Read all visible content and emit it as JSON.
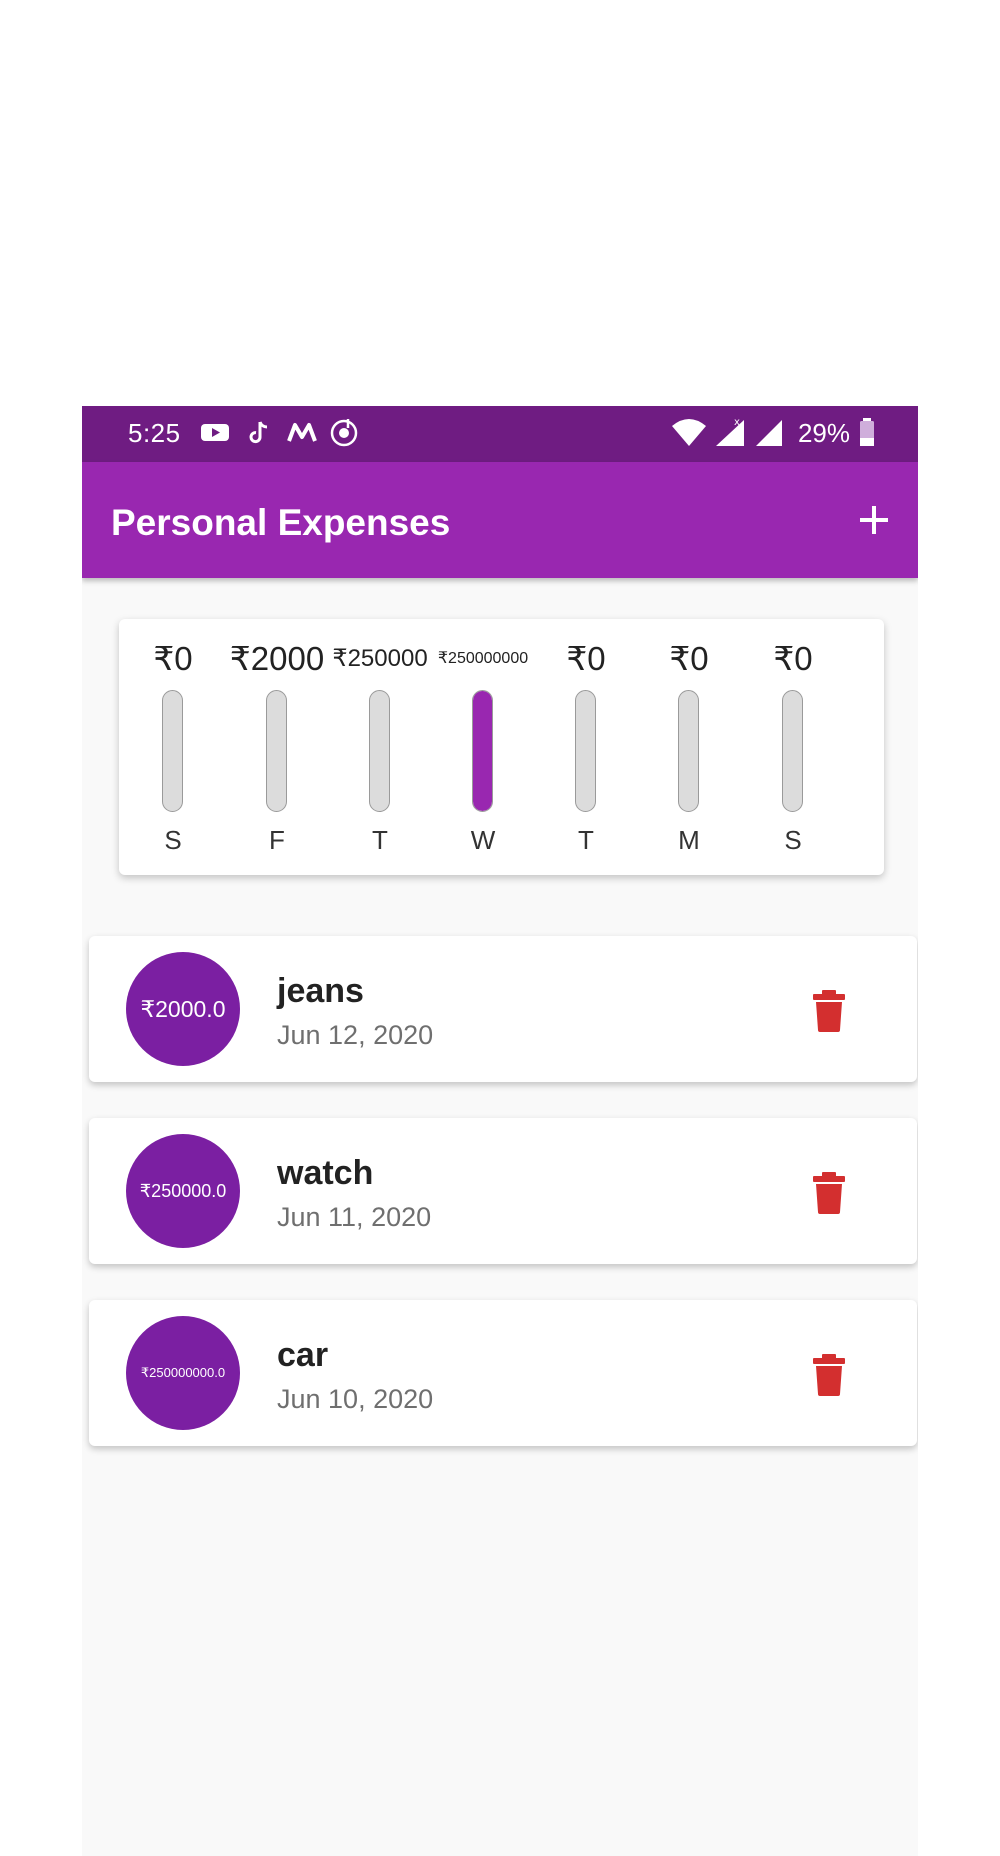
{
  "status_bar": {
    "time": "5:25",
    "battery": "29%",
    "icons": [
      "youtube-icon",
      "tiktok-icon",
      "m-app-icon",
      "music-icon",
      "wifi-icon",
      "signal-icon",
      "signal-icon-2",
      "battery-icon"
    ]
  },
  "app_bar": {
    "title": "Personal Expenses",
    "add_icon": "plus-icon"
  },
  "colors": {
    "primary": "#9927b0",
    "primary_dark": "#6f1c82",
    "avatar": "#7b1fa2",
    "delete": "#d32f2f"
  },
  "chart": {
    "bars": [
      {
        "amount": "₹0",
        "day": "S",
        "fill": 0
      },
      {
        "amount": "₹2000",
        "day": "F",
        "fill": 7.9e-06
      },
      {
        "amount": "₹250000",
        "day": "T",
        "fill": 0.00099
      },
      {
        "amount": "₹250000000",
        "day": "W",
        "fill": 1.0
      },
      {
        "amount": "₹0",
        "day": "T",
        "fill": 0
      },
      {
        "amount": "₹0",
        "day": "M",
        "fill": 0
      },
      {
        "amount": "₹0",
        "day": "S",
        "fill": 0
      }
    ]
  },
  "transactions": [
    {
      "amount": "₹2000.0",
      "title": "jeans",
      "date": "Jun 12, 2020",
      "delete_icon": "trash-icon"
    },
    {
      "amount": "₹250000.0",
      "title": "watch",
      "date": "Jun 11, 2020",
      "delete_icon": "trash-icon"
    },
    {
      "amount": "₹250000000.0",
      "title": "car",
      "date": "Jun 10, 2020",
      "delete_icon": "trash-icon"
    }
  ]
}
